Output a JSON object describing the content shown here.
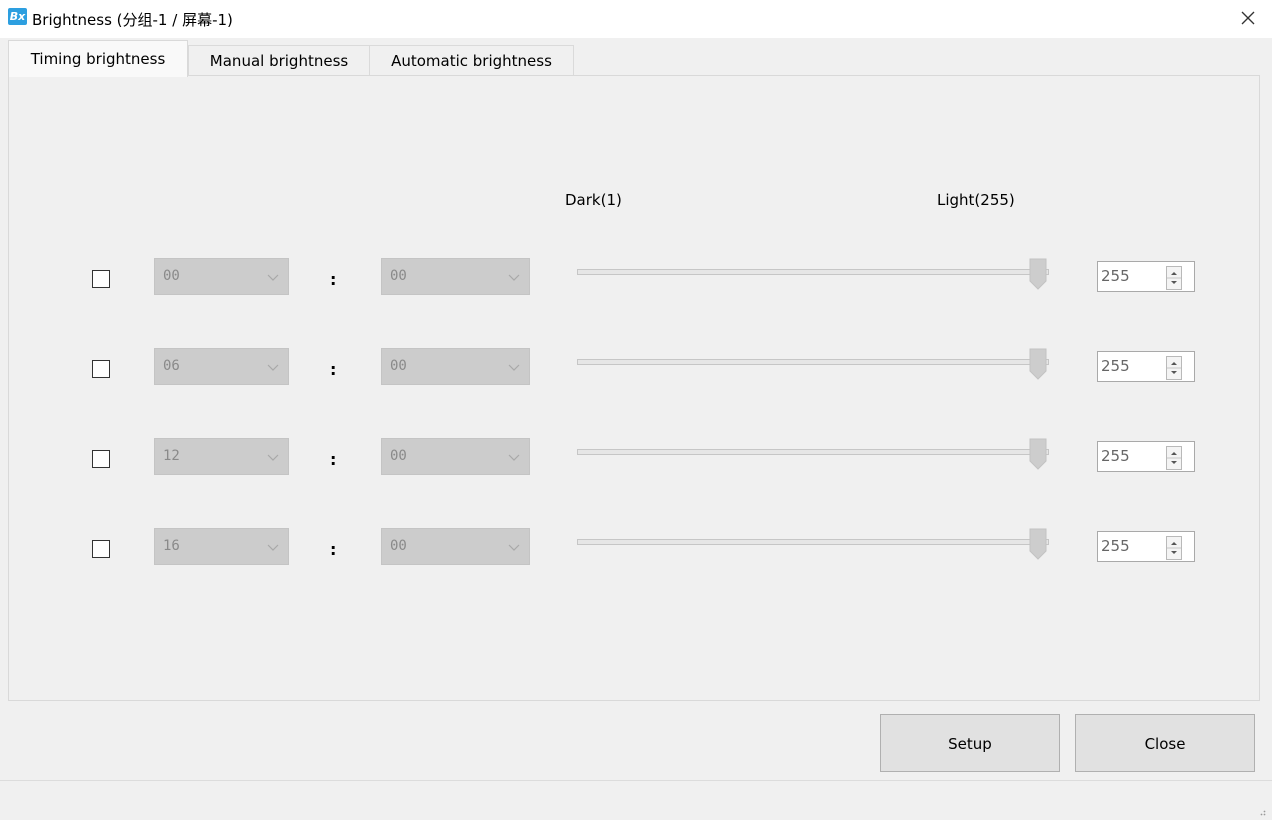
{
  "window": {
    "title": "Brightness  (分组-1 / 屏幕-1)",
    "icon_text": "Bx",
    "accent_color": "#2d9fe0"
  },
  "tabs": [
    {
      "label": "Timing brightness",
      "active": true
    },
    {
      "label": "Manual brightness",
      "active": false
    },
    {
      "label": "Automatic brightness",
      "active": false
    }
  ],
  "slider_labels": {
    "dark": "Dark(1)",
    "light": "Light(255)"
  },
  "rows": [
    {
      "checked": false,
      "hour": "00",
      "minute": "00",
      "brightness": 255,
      "value_text": "255"
    },
    {
      "checked": false,
      "hour": "06",
      "minute": "00",
      "brightness": 255,
      "value_text": "255"
    },
    {
      "checked": false,
      "hour": "12",
      "minute": "00",
      "brightness": 255,
      "value_text": "255"
    },
    {
      "checked": false,
      "hour": "16",
      "minute": "00",
      "brightness": 255,
      "value_text": "255"
    }
  ],
  "separator": ":",
  "buttons": {
    "setup": "Setup",
    "close": "Close"
  },
  "slider_range": {
    "min": 1,
    "max": 255
  }
}
